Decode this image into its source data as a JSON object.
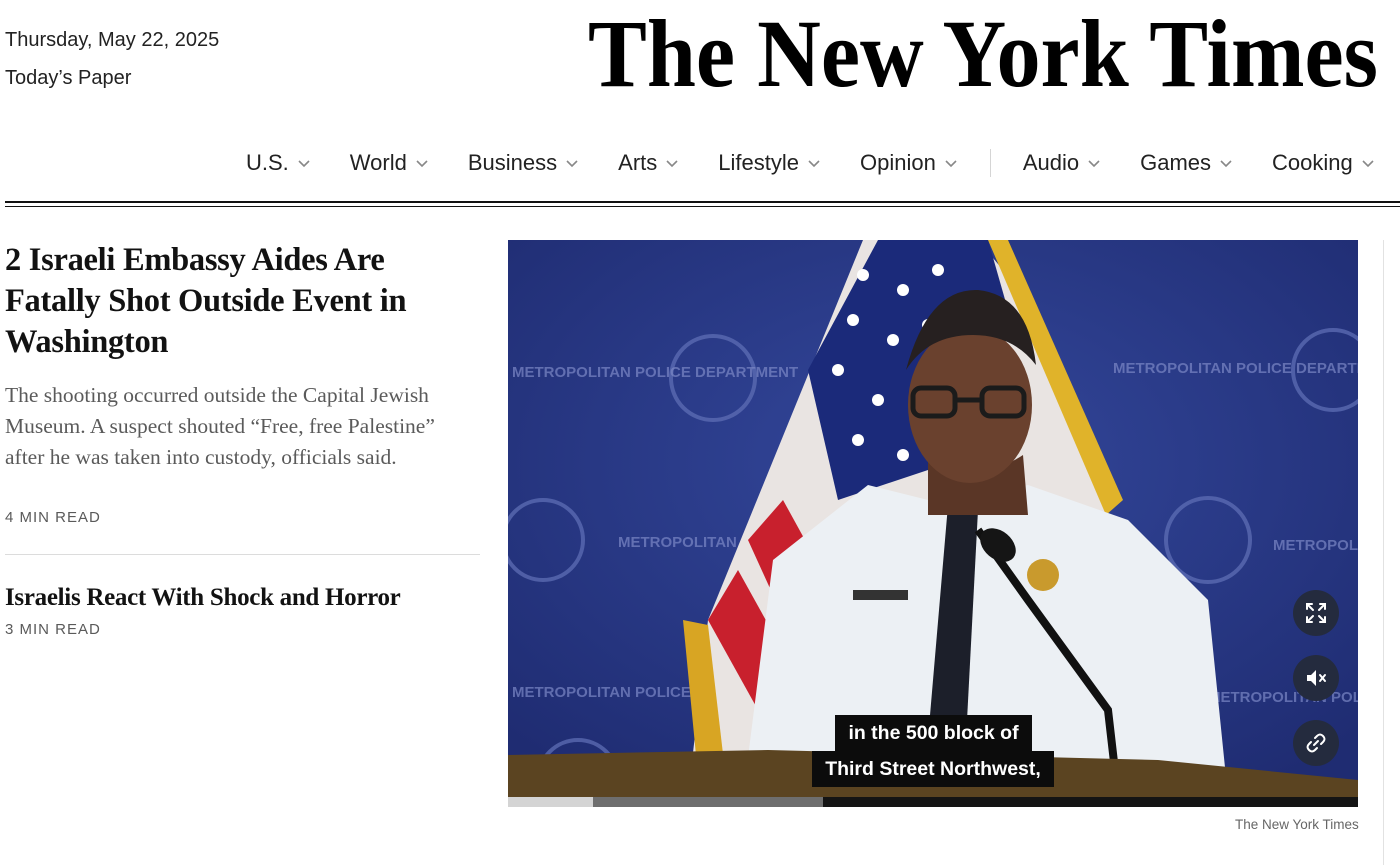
{
  "header": {
    "date": "Thursday, May 22, 2025",
    "todays_paper": "Today’s Paper",
    "masthead": "The New York Times"
  },
  "nav": {
    "items": [
      {
        "label": "U.S."
      },
      {
        "label": "World"
      },
      {
        "label": "Business"
      },
      {
        "label": "Arts"
      },
      {
        "label": "Lifestyle"
      },
      {
        "label": "Opinion"
      },
      {
        "label": "Audio"
      },
      {
        "label": "Games"
      },
      {
        "label": "Cooking"
      }
    ]
  },
  "lead_story": {
    "headline": "2 Israeli Embassy Aides Are Fatally Shot Outside Event in Washington",
    "summary": "The shooting occurred outside the Capital Jewish Museum. A suspect shouted “Free, free Palestine” after he was taken into custody, officials said.",
    "read_time": "4 MIN READ"
  },
  "second_story": {
    "headline": "Israelis React With Shock and Horror",
    "read_time": "3 MIN READ"
  },
  "video": {
    "caption_line_1": "in the 500 block of",
    "caption_line_2": "Third Street Northwest,",
    "backdrop_text": "METROPOLITAN POLICE DEPARTMENT",
    "played_fraction": 0.1,
    "buffered_fraction": 0.37,
    "credit": "The New York Times",
    "controls": [
      "fullscreen-icon",
      "mute-icon",
      "link-icon"
    ]
  },
  "colors": {
    "text": "#121212",
    "summary_gray": "#5a5a5a",
    "video_backdrop": "#2a3a8a",
    "control_bg": "#242b3e"
  }
}
